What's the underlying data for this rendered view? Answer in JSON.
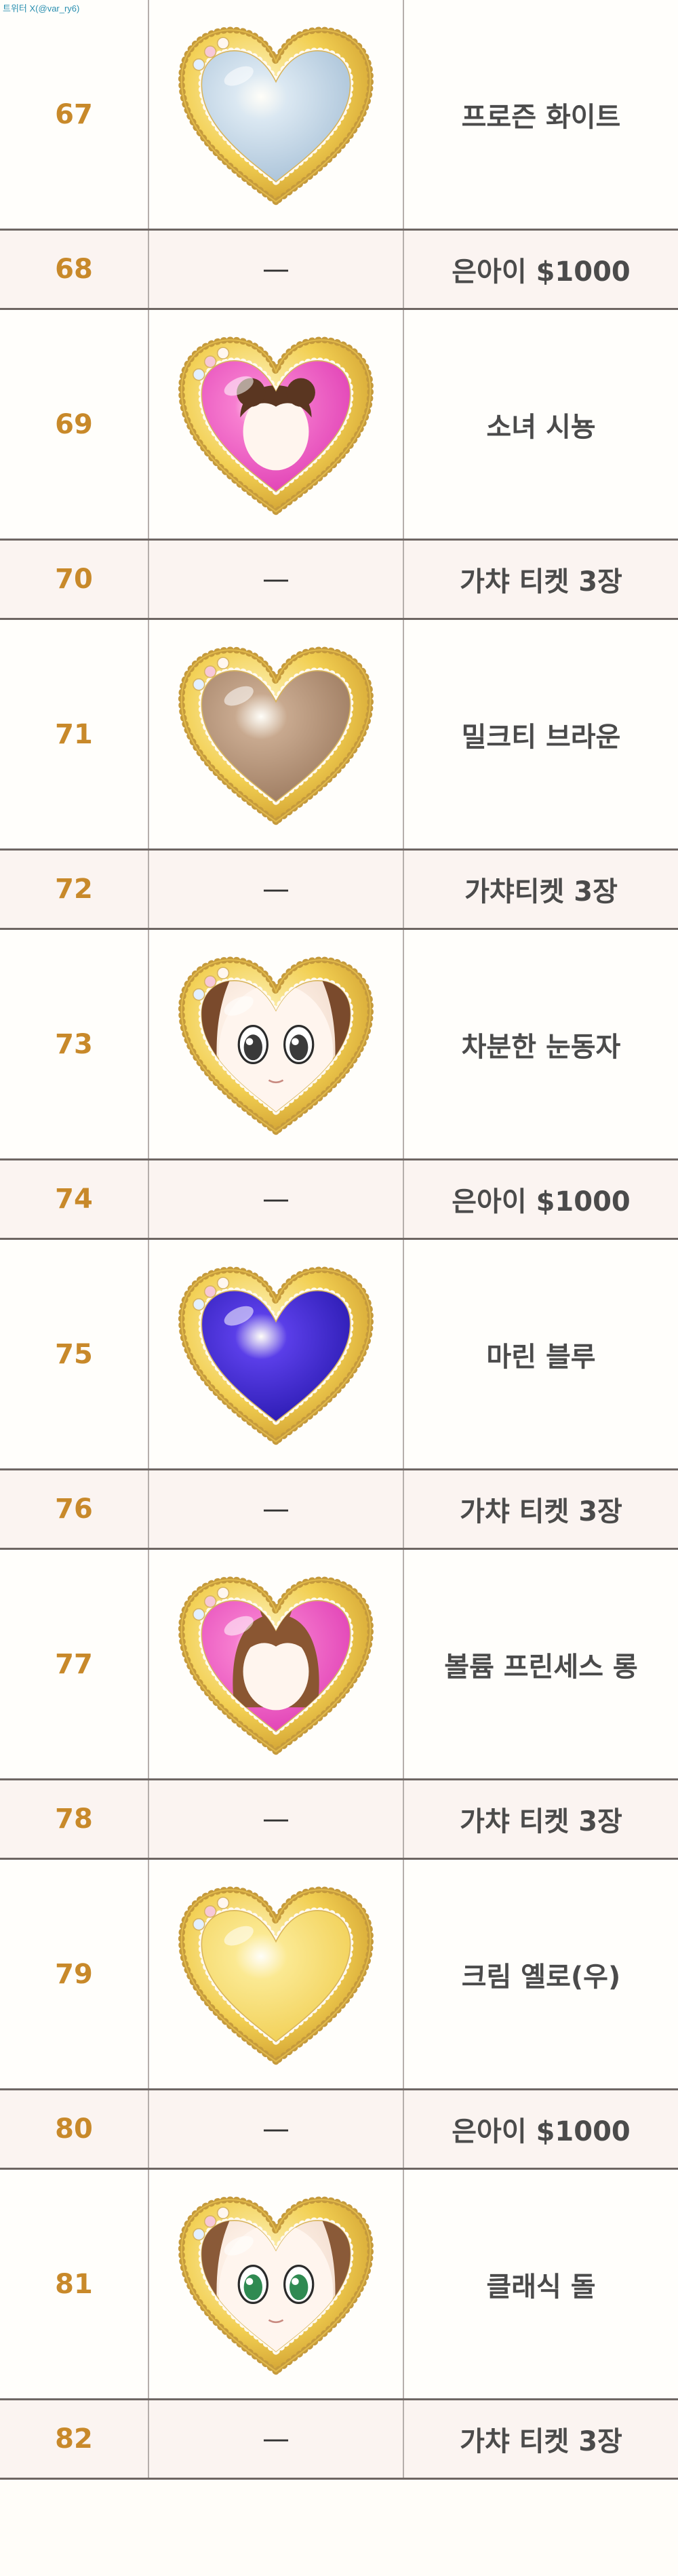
{
  "credit": "트위터 X(@var_ry6)",
  "rows": [
    {
      "level": "67",
      "item": "heart-frozen-white",
      "name": "프로즌 화이트",
      "tall": true,
      "fill": "#dbe8f2",
      "fill2": "#a9c2d8"
    },
    {
      "level": "68",
      "item": "—",
      "name": "은아이 $1000",
      "tall": false
    },
    {
      "level": "69",
      "item": "heart-hair-pink",
      "name": "소녀 시뇽",
      "tall": true,
      "fill": "#f77ed0",
      "fill2": "#e040b5",
      "hair": "#5a3621"
    },
    {
      "level": "70",
      "item": "—",
      "name": "가챠 티켓 3장",
      "tall": false
    },
    {
      "level": "71",
      "item": "heart-milktea-brown",
      "name": "밀크티 브라운",
      "tall": true,
      "fill": "#c8a98f",
      "fill2": "#9d7b60"
    },
    {
      "level": "72",
      "item": "—",
      "name": "가챠티켓 3장",
      "tall": false
    },
    {
      "level": "73",
      "item": "heart-face-calm-eyes",
      "name": "차분한 눈동자",
      "tall": true,
      "fill": "#fff3ea",
      "fill2": "#f0d9c9",
      "hair": "#7a4a2c",
      "eye": "#3a3a3a"
    },
    {
      "level": "74",
      "item": "—",
      "name": "은아이 $1000",
      "tall": false
    },
    {
      "level": "75",
      "item": "heart-marine-blue",
      "name": "마린 블루",
      "tall": true,
      "fill": "#5a3ee8",
      "fill2": "#2a1ab0"
    },
    {
      "level": "76",
      "item": "—",
      "name": "가챠 티켓 3장",
      "tall": false
    },
    {
      "level": "77",
      "item": "heart-hair-volume-princess",
      "name": "볼륨 프린세스 롱",
      "tall": true,
      "fill": "#f77ed0",
      "fill2": "#e040b5",
      "hair": "#8a5632"
    },
    {
      "level": "78",
      "item": "—",
      "name": "가챠 티켓 3장",
      "tall": false
    },
    {
      "level": "79",
      "item": "heart-cream-yellow",
      "name": "크림 옐로(우)",
      "tall": true,
      "fill": "#fbe992",
      "fill2": "#f1cf55"
    },
    {
      "level": "80",
      "item": "—",
      "name": "은아이 $1000",
      "tall": false
    },
    {
      "level": "81",
      "item": "heart-face-classic-doll",
      "name": "클래식 돌",
      "tall": true,
      "fill": "#fff3ea",
      "fill2": "#f0d9c9",
      "hair": "#8a5a38",
      "eye": "#2f8a52"
    },
    {
      "level": "82",
      "item": "—",
      "name": "가챠 티켓 3장",
      "tall": false
    }
  ]
}
